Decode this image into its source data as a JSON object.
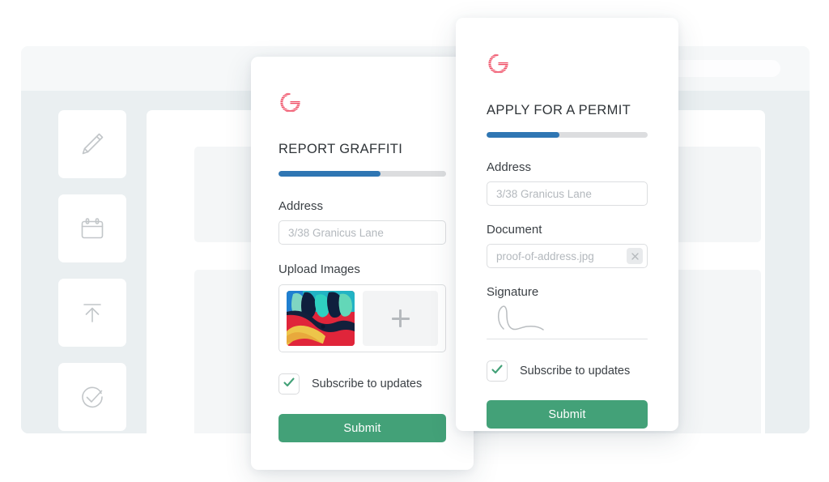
{
  "background": {
    "window_name": "app-window",
    "search_pill": "",
    "rail_icons": [
      {
        "name": "pencil-icon"
      },
      {
        "name": "calendar-icon"
      },
      {
        "name": "upload-icon"
      },
      {
        "name": "check-circle-icon"
      }
    ],
    "skeleton_blocks": [
      "content-block-1",
      "content-block-2"
    ]
  },
  "colors": {
    "brand_logo": "#ef4a62",
    "progress_fill": "#2f76b3",
    "progress_track": "#dcdddf",
    "submit_button": "#43a178",
    "check_green": "#43a178",
    "canvas": "#ffffff",
    "window_body": "#eaeff1",
    "window_topbar": "#f6f8f9",
    "placeholder_text": "#b3b8bd"
  },
  "graffiti_form": {
    "logo_alt": "Granicus G logo",
    "title": "REPORT GRAFFITI",
    "progress_percent": 61,
    "address": {
      "label": "Address",
      "placeholder": "3/38 Granicus Lane",
      "value": ""
    },
    "upload": {
      "label": "Upload Images",
      "thumbnail_alt": "graffiti-photo",
      "add_label": "+"
    },
    "subscribe": {
      "label": "Subscribe to updates",
      "checked": true
    },
    "submit_label": "Submit"
  },
  "permit_form": {
    "logo_alt": "Granicus G logo",
    "title": "APPLY FOR A PERMIT",
    "progress_percent": 45,
    "address": {
      "label": "Address",
      "placeholder": "3/38 Granicus Lane",
      "value": ""
    },
    "document": {
      "label": "Document",
      "placeholder": "proof-of-address.jpg",
      "value": "",
      "clear_label": "×"
    },
    "signature": {
      "label": "Signature",
      "alt": "handwritten-signature"
    },
    "subscribe": {
      "label": "Subscribe to updates",
      "checked": true
    },
    "submit_label": "Submit"
  }
}
